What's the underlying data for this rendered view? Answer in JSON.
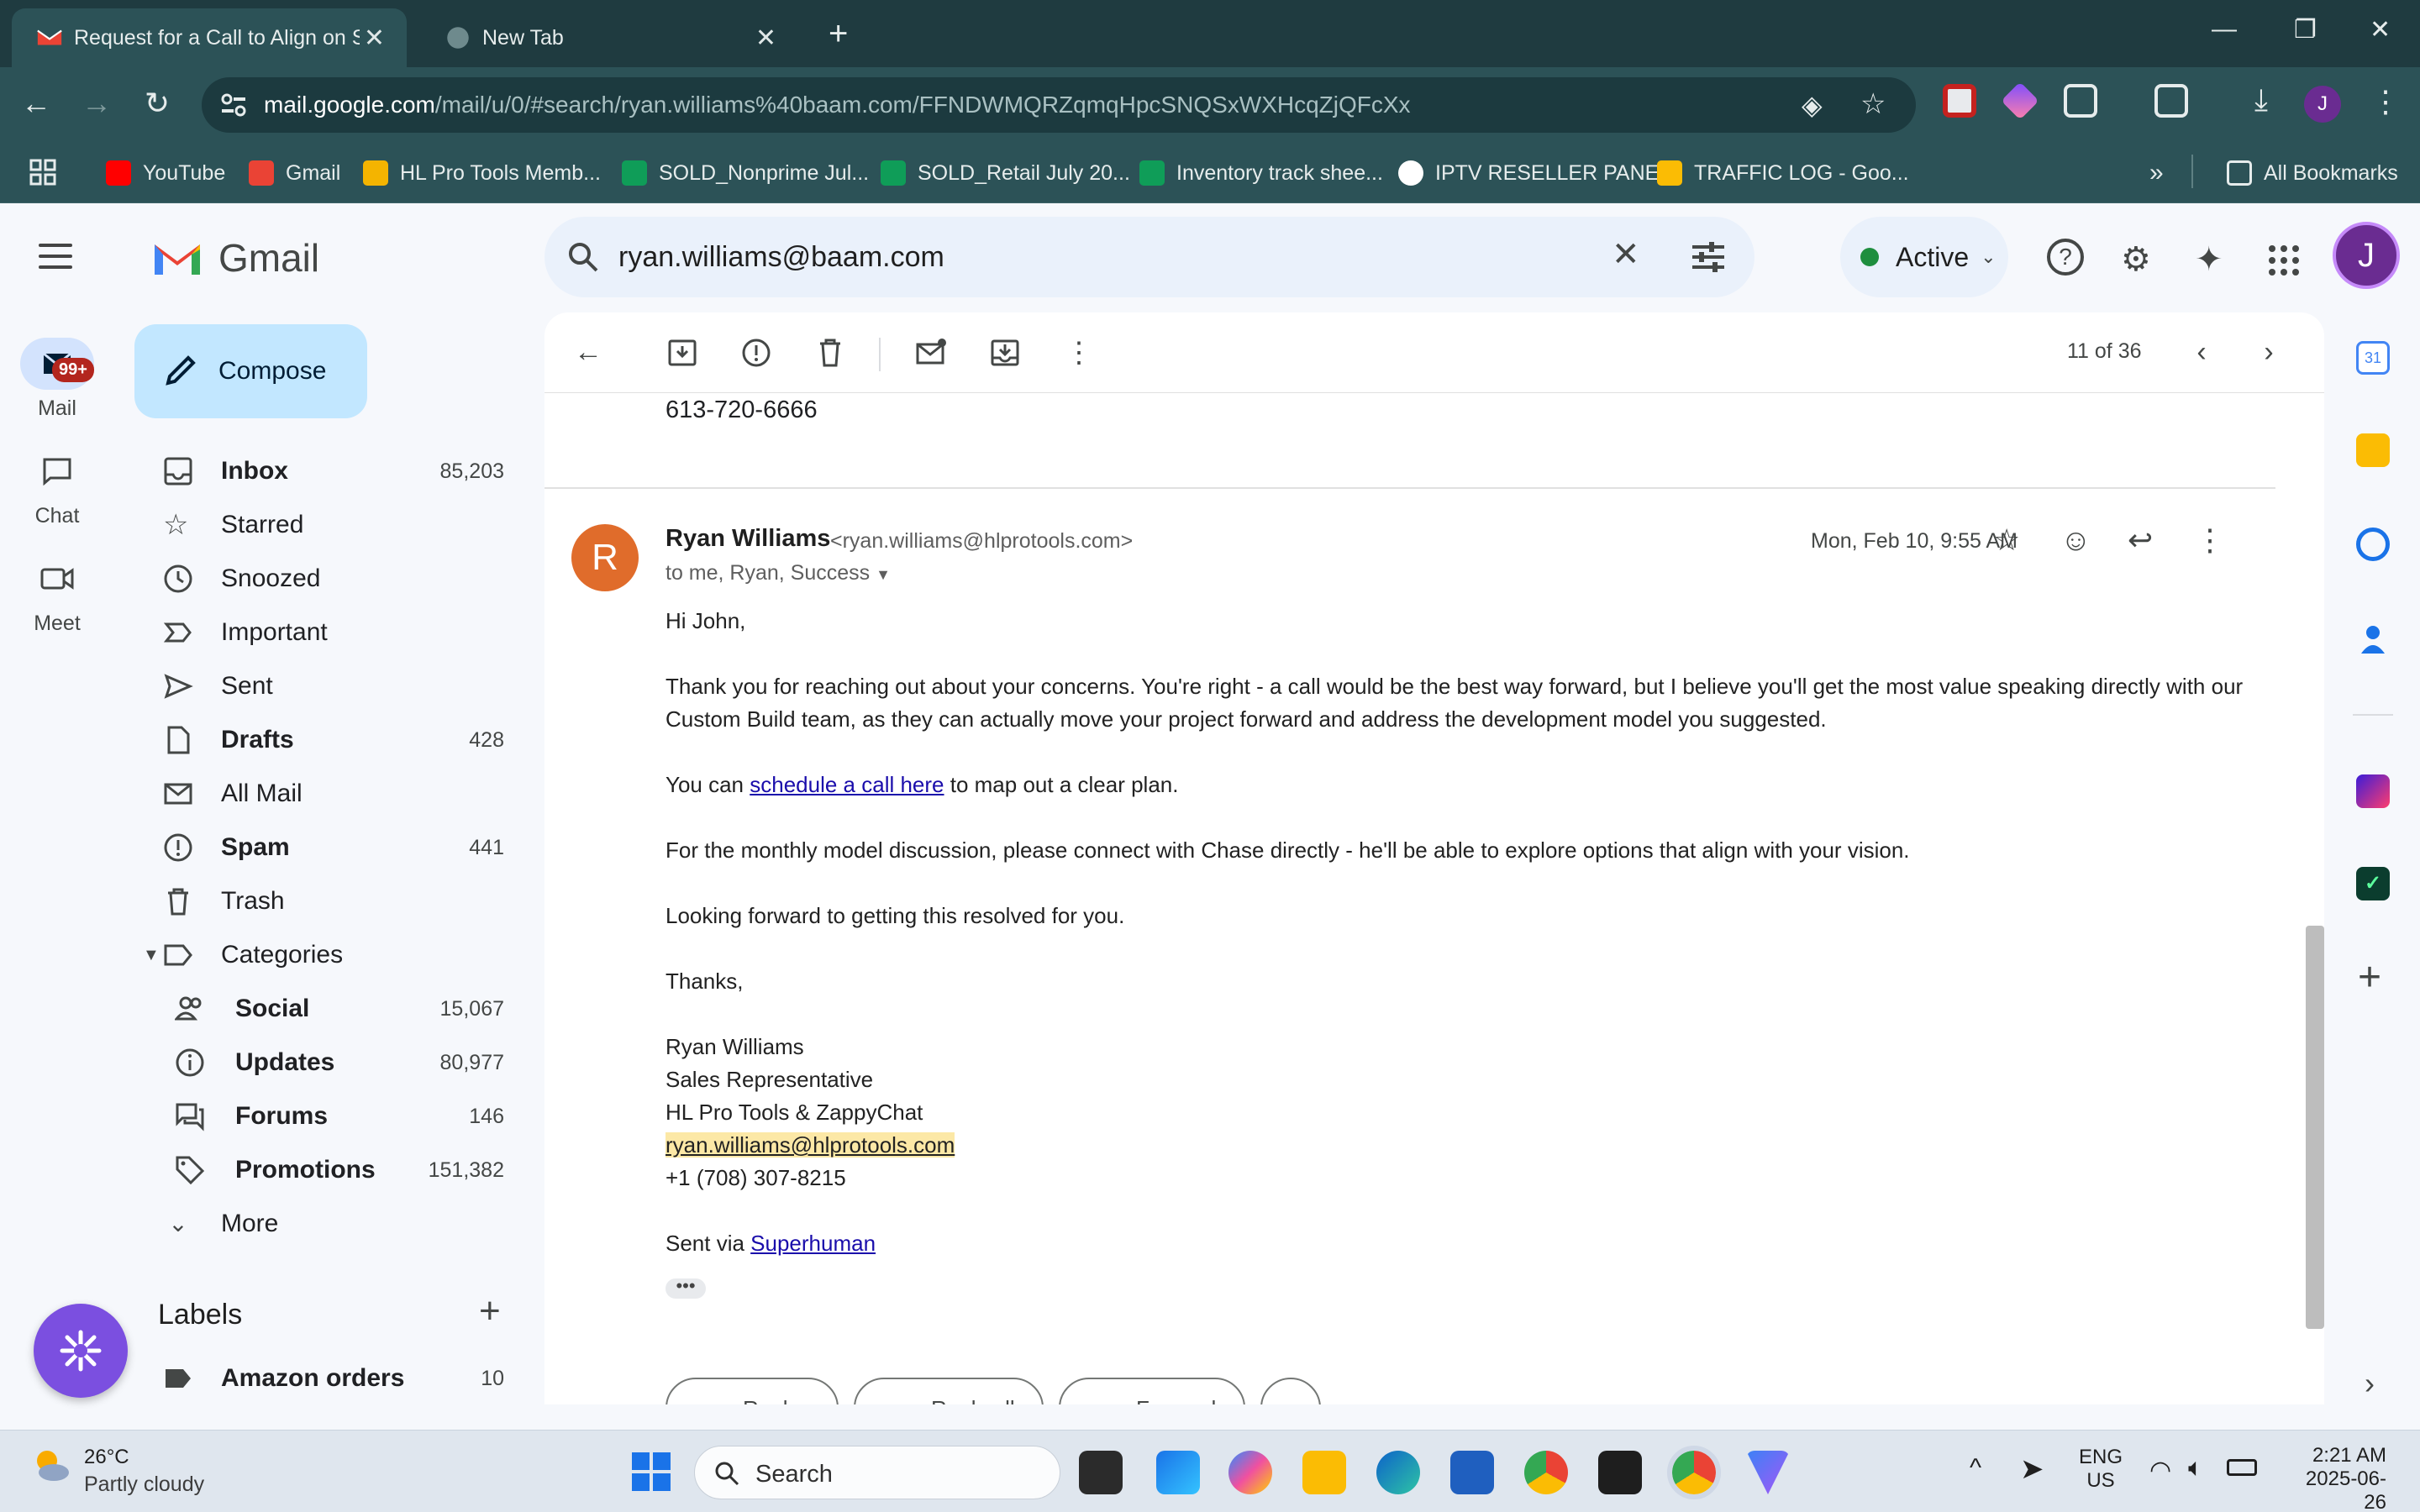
{
  "browser": {
    "tabs": [
      {
        "title": "Request for a Call to Align on S",
        "active": true
      },
      {
        "title": "New Tab",
        "active": false
      }
    ],
    "url_host": "mail.google.com",
    "url_path": "/mail/u/0/#search/ryan.williams%40baam.com/FFNDWMQRZqmqHpcSNQSxWXHcqZjQFcXx",
    "profile_initial": "J",
    "bookmarks": [
      {
        "label": "YouTube",
        "color": "#ff0000"
      },
      {
        "label": "Gmail",
        "color": "#ea4335"
      },
      {
        "label": "HL Pro Tools Memb...",
        "color": "#f4b400"
      },
      {
        "label": "SOLD_Nonprime Jul...",
        "color": "#0f9d58"
      },
      {
        "label": "SOLD_Retail July 20...",
        "color": "#0f9d58"
      },
      {
        "label": "Inventory track shee...",
        "color": "#0f9d58"
      },
      {
        "label": "IPTV RESELLER PANEL",
        "color": "#ffffff"
      },
      {
        "label": "TRAFFIC LOG - Goo...",
        "color": "#fbbc04"
      }
    ],
    "all_bookmarks": "All Bookmarks"
  },
  "gmail": {
    "brand": "Gmail",
    "search_query": "ryan.williams@baam.com",
    "status": "Active",
    "account_initial": "J",
    "rail": [
      {
        "label": "Mail",
        "badge": "99+"
      },
      {
        "label": "Chat"
      },
      {
        "label": "Meet"
      }
    ],
    "compose_label": "Compose",
    "nav": [
      {
        "label": "Inbox",
        "count": "85,203",
        "bold": true
      },
      {
        "label": "Starred",
        "count": ""
      },
      {
        "label": "Snoozed",
        "count": ""
      },
      {
        "label": "Important",
        "count": ""
      },
      {
        "label": "Sent",
        "count": ""
      },
      {
        "label": "Drafts",
        "count": "428",
        "bold": true
      },
      {
        "label": "All Mail",
        "count": ""
      },
      {
        "label": "Spam",
        "count": "441",
        "bold": true
      },
      {
        "label": "Trash",
        "count": ""
      },
      {
        "label": "Categories",
        "count": ""
      }
    ],
    "categories": [
      {
        "label": "Social",
        "count": "15,067"
      },
      {
        "label": "Updates",
        "count": "80,977"
      },
      {
        "label": "Forums",
        "count": "146"
      },
      {
        "label": "Promotions",
        "count": "151,382"
      }
    ],
    "more_label": "More",
    "labels_header": "Labels",
    "labels": [
      {
        "label": "Amazon orders",
        "count": "10"
      }
    ]
  },
  "thread": {
    "pager": "11 of 36",
    "previous_phone": "613-720-6666",
    "message": {
      "sender_initial": "R",
      "sender_name": "Ryan Williams",
      "sender_email": "<ryan.williams@hlprotools.com>",
      "recipients": "to me, Ryan, Success",
      "date": "Mon, Feb 10, 9:55 AM",
      "greeting": "Hi John,",
      "para1_line1": "Thank you for reaching out about your concerns. You're right - a call would be the best way forward, but I believe you'll get the most value speaking directly with our",
      "para1_line2": "Custom Build team, as they can actually move your project forward and address the development model you suggested.",
      "para2_pre": "You can ",
      "para2_link": "schedule a call here",
      "para2_post": " to map out a clear plan.",
      "para3": "For the monthly model discussion, please connect with Chase directly - he'll be able to explore options that align with your vision.",
      "para4": "Looking forward to getting this resolved for you.",
      "closing": "Thanks,",
      "sig_name": "Ryan Williams",
      "sig_title": "Sales Representative",
      "sig_company": "HL Pro Tools & ZappyChat",
      "sig_email": "ryan.williams@hlprotools.com",
      "sig_phone": "+1 (708) 307-8215",
      "sent_via_pre": "Sent via ",
      "sent_via_link": "Superhuman"
    },
    "reply_buttons": [
      "Reply",
      "Reply all",
      "Forward"
    ]
  },
  "taskbar": {
    "temperature": "26°C",
    "weather": "Partly cloudy",
    "search_placeholder": "Search",
    "lang_line1": "ENG",
    "lang_line2": "US",
    "time": "2:21 AM",
    "date": "2025-06-26"
  }
}
